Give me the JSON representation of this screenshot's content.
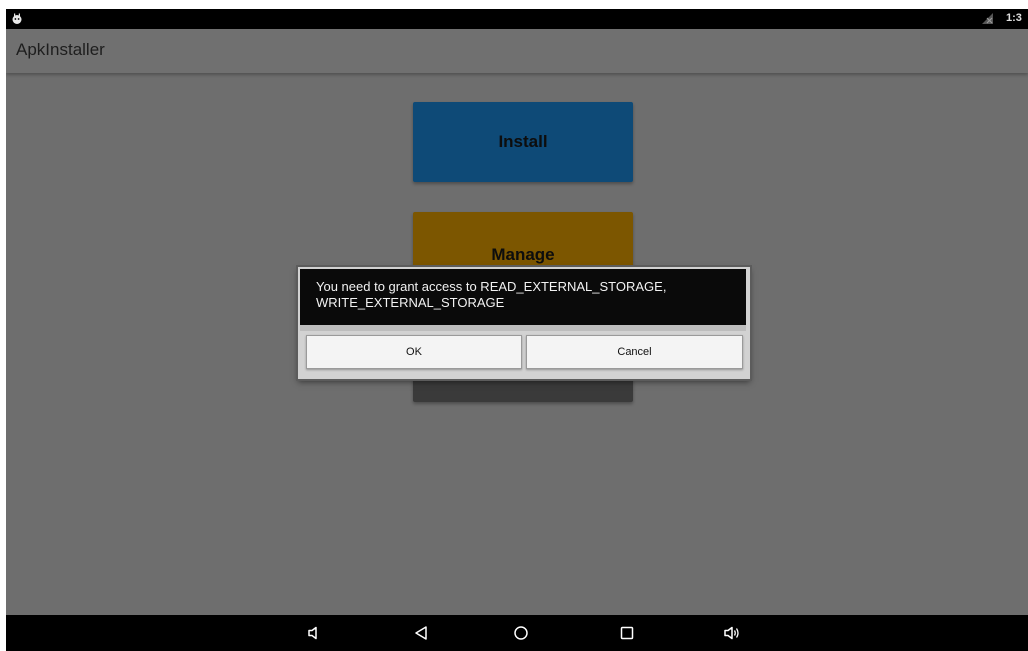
{
  "status_bar": {
    "time": "1:3",
    "left_icon": "android-notification-icon",
    "signal_icon": "no-signal-icon"
  },
  "app_bar": {
    "title": "ApkInstaller"
  },
  "main": {
    "install_label": "Install",
    "manage_label": "Manage",
    "colors": {
      "install": "#0e4a77",
      "manage": "#7c5600",
      "third": "#3a3a3a"
    }
  },
  "dialog": {
    "message": "You need to grant access to READ_EXTERNAL_STORAGE, WRITE_EXTERNAL_STORAGE",
    "ok_label": "OK",
    "cancel_label": "Cancel"
  },
  "nav_bar": {
    "icons": [
      "volume-down-icon",
      "back-icon",
      "home-icon",
      "recents-icon",
      "volume-up-icon"
    ]
  }
}
